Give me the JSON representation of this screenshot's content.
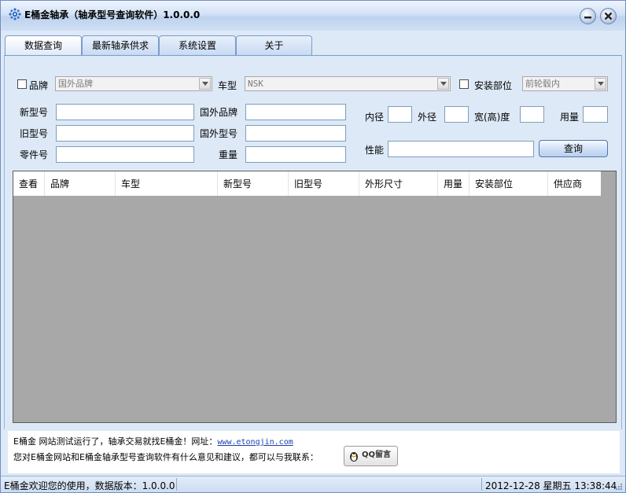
{
  "window": {
    "title": "E桶金轴承（轴承型号查询软件）1.0.0.0",
    "minimize_icon": "minimize-icon",
    "close_icon": "close-icon"
  },
  "tabs": [
    {
      "label": "数据查询",
      "active": true
    },
    {
      "label": "最新轴承供求",
      "active": false
    },
    {
      "label": "系统设置",
      "active": false
    },
    {
      "label": "关于",
      "active": false
    }
  ],
  "filters": {
    "brand_label": "品牌",
    "brand_value": "国外品牌",
    "car_type_label": "车型",
    "car_type_value": "NSK",
    "install_label": "安装部位",
    "install_value": "前轮毂内",
    "new_model_label": "新型号",
    "old_model_label": "旧型号",
    "part_no_label": "零件号",
    "foreign_brand_label": "国外品牌",
    "foreign_model_label": "国外型号",
    "weight_label": "重量",
    "inner_label": "内径",
    "outer_label": "外径",
    "width_label": "宽(高)度",
    "usage_label": "用量",
    "performance_label": "性能",
    "query_button": "查询"
  },
  "grid": {
    "columns": [
      "查看",
      "品牌",
      "车型",
      "新型号",
      "旧型号",
      "外形尺寸",
      "用量",
      "安装部位",
      "供应商"
    ]
  },
  "info": {
    "line1_prefix": "E桶金 网站测试运行了，轴承交易就找E桶金！网址：",
    "url": "www.etongjin.com",
    "line2": "您对E桶金网站和E桶金轴承型号查询软件有什么意见和建议，都可以与我联系：",
    "qq_button": "QQ留言"
  },
  "status": {
    "left": "E桶金欢迎您的使用，数据版本：1.0.0.0",
    "right": "2012-12-28 星期五 13:38:44"
  },
  "colors": {
    "accent": "#7b9cc8",
    "grid_bg": "#a8a8a8",
    "link": "#1a3fb0"
  }
}
